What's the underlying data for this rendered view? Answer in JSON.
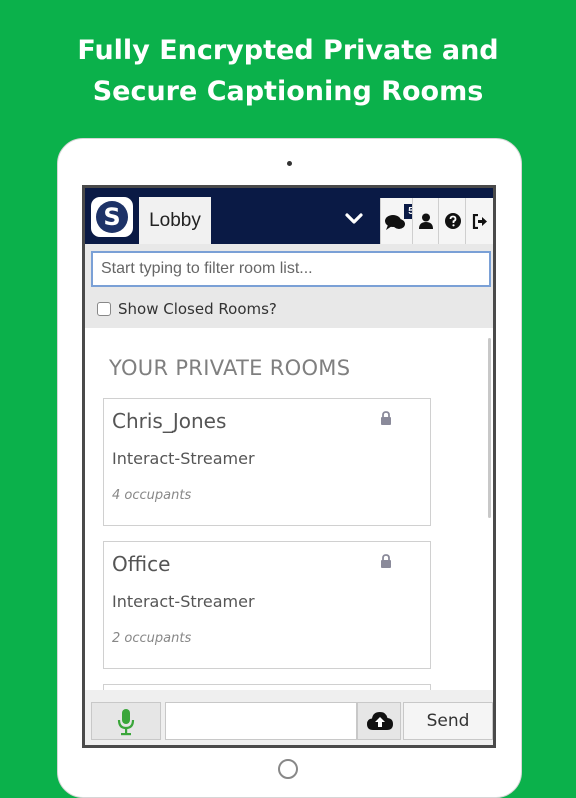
{
  "promo": {
    "line1": "Fully Encrypted Private and",
    "line2": "Secure Captioning Rooms"
  },
  "topbar": {
    "logo_letter": "S",
    "tab_label": "Lobby",
    "dropdown_icon": "chevron-down-icon",
    "chat_badge": "5",
    "icons": [
      "chat-bubbles-icon",
      "user-icon",
      "help-icon",
      "sign-out-icon"
    ]
  },
  "filter": {
    "placeholder": "Start typing to filter room list...",
    "value": ""
  },
  "show_closed": {
    "label": "Show Closed Rooms?",
    "checked": false
  },
  "rooms": {
    "section_title": "YOUR PRIVATE ROOMS",
    "items": [
      {
        "name": "Chris_Jones",
        "type": "Interact-Streamer",
        "occupants": "4 occupants",
        "icon": "lock-icon"
      },
      {
        "name": "Office",
        "type": "Interact-Streamer",
        "occupants": "2 occupants",
        "icon": "lock-icon"
      }
    ]
  },
  "composer": {
    "mic_icon": "microphone-icon",
    "message_value": "",
    "upload_icon": "cloud-upload-icon",
    "send_label": "Send"
  },
  "colors": {
    "background": "#0bb14b",
    "topbar": "#0a1a45",
    "mic": "#3aa63a"
  }
}
